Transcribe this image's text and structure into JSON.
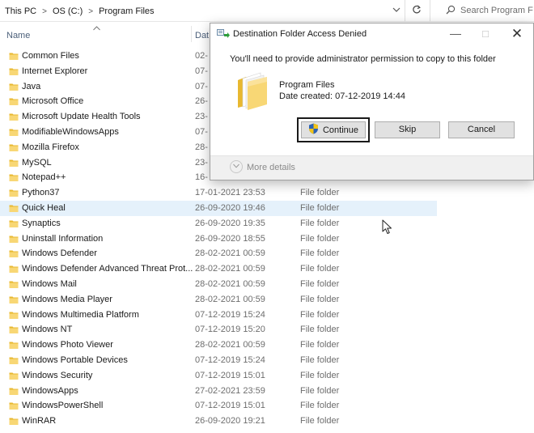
{
  "address_bar": {
    "crumbs": [
      "This PC",
      "OS (C:)",
      "Program Files"
    ],
    "search_placeholder": "Search Program F"
  },
  "columns": {
    "name": "Name",
    "date": "Dat"
  },
  "files": [
    {
      "name": "Common Files",
      "date": "02-",
      "type": ""
    },
    {
      "name": "Internet Explorer",
      "date": "07-",
      "type": ""
    },
    {
      "name": "Java",
      "date": "07-",
      "type": ""
    },
    {
      "name": "Microsoft Office",
      "date": "26-",
      "type": ""
    },
    {
      "name": "Microsoft Update Health Tools",
      "date": "23-",
      "type": ""
    },
    {
      "name": "ModifiableWindowsApps",
      "date": "07-",
      "type": ""
    },
    {
      "name": "Mozilla Firefox",
      "date": "28-",
      "type": ""
    },
    {
      "name": "MySQL",
      "date": "23-",
      "type": ""
    },
    {
      "name": "Notepad++",
      "date": "16-",
      "type": ""
    },
    {
      "name": "Python37",
      "date": "17-01-2021 23:53",
      "type": "File folder"
    },
    {
      "name": "Quick Heal",
      "date": "26-09-2020 19:46",
      "type": "File folder"
    },
    {
      "name": "Synaptics",
      "date": "26-09-2020 19:35",
      "type": "File folder"
    },
    {
      "name": "Uninstall Information",
      "date": "26-09-2020 18:55",
      "type": "File folder"
    },
    {
      "name": "Windows Defender",
      "date": "28-02-2021 00:59",
      "type": "File folder"
    },
    {
      "name": "Windows Defender Advanced Threat Prot...",
      "date": "28-02-2021 00:59",
      "type": "File folder"
    },
    {
      "name": "Windows Mail",
      "date": "28-02-2021 00:59",
      "type": "File folder"
    },
    {
      "name": "Windows Media Player",
      "date": "28-02-2021 00:59",
      "type": "File folder"
    },
    {
      "name": "Windows Multimedia Platform",
      "date": "07-12-2019 15:24",
      "type": "File folder"
    },
    {
      "name": "Windows NT",
      "date": "07-12-2019 15:20",
      "type": "File folder"
    },
    {
      "name": "Windows Photo Viewer",
      "date": "28-02-2021 00:59",
      "type": "File folder"
    },
    {
      "name": "Windows Portable Devices",
      "date": "07-12-2019 15:24",
      "type": "File folder"
    },
    {
      "name": "Windows Security",
      "date": "07-12-2019 15:01",
      "type": "File folder"
    },
    {
      "name": "WindowsApps",
      "date": "27-02-2021 23:59",
      "type": "File folder"
    },
    {
      "name": "WindowsPowerShell",
      "date": "07-12-2019 15:01",
      "type": "File folder"
    },
    {
      "name": "WinRAR",
      "date": "26-09-2020 19:21",
      "type": "File folder"
    }
  ],
  "selected_file": "Quick Heal",
  "dialog": {
    "title": "Destination Folder Access Denied",
    "message": "You'll need to provide administrator permission to copy to this folder",
    "item_name": "Program Files",
    "item_date": "Date created: 07-12-2019 14:44",
    "continue_label": "Continue",
    "skip_label": "Skip",
    "cancel_label": "Cancel",
    "more_details_label": "More details"
  },
  "colors": {
    "folder": "#f8d775",
    "folder_dark": "#e8b830",
    "selection": "#e5f1fb",
    "accent": "#0078d7"
  }
}
